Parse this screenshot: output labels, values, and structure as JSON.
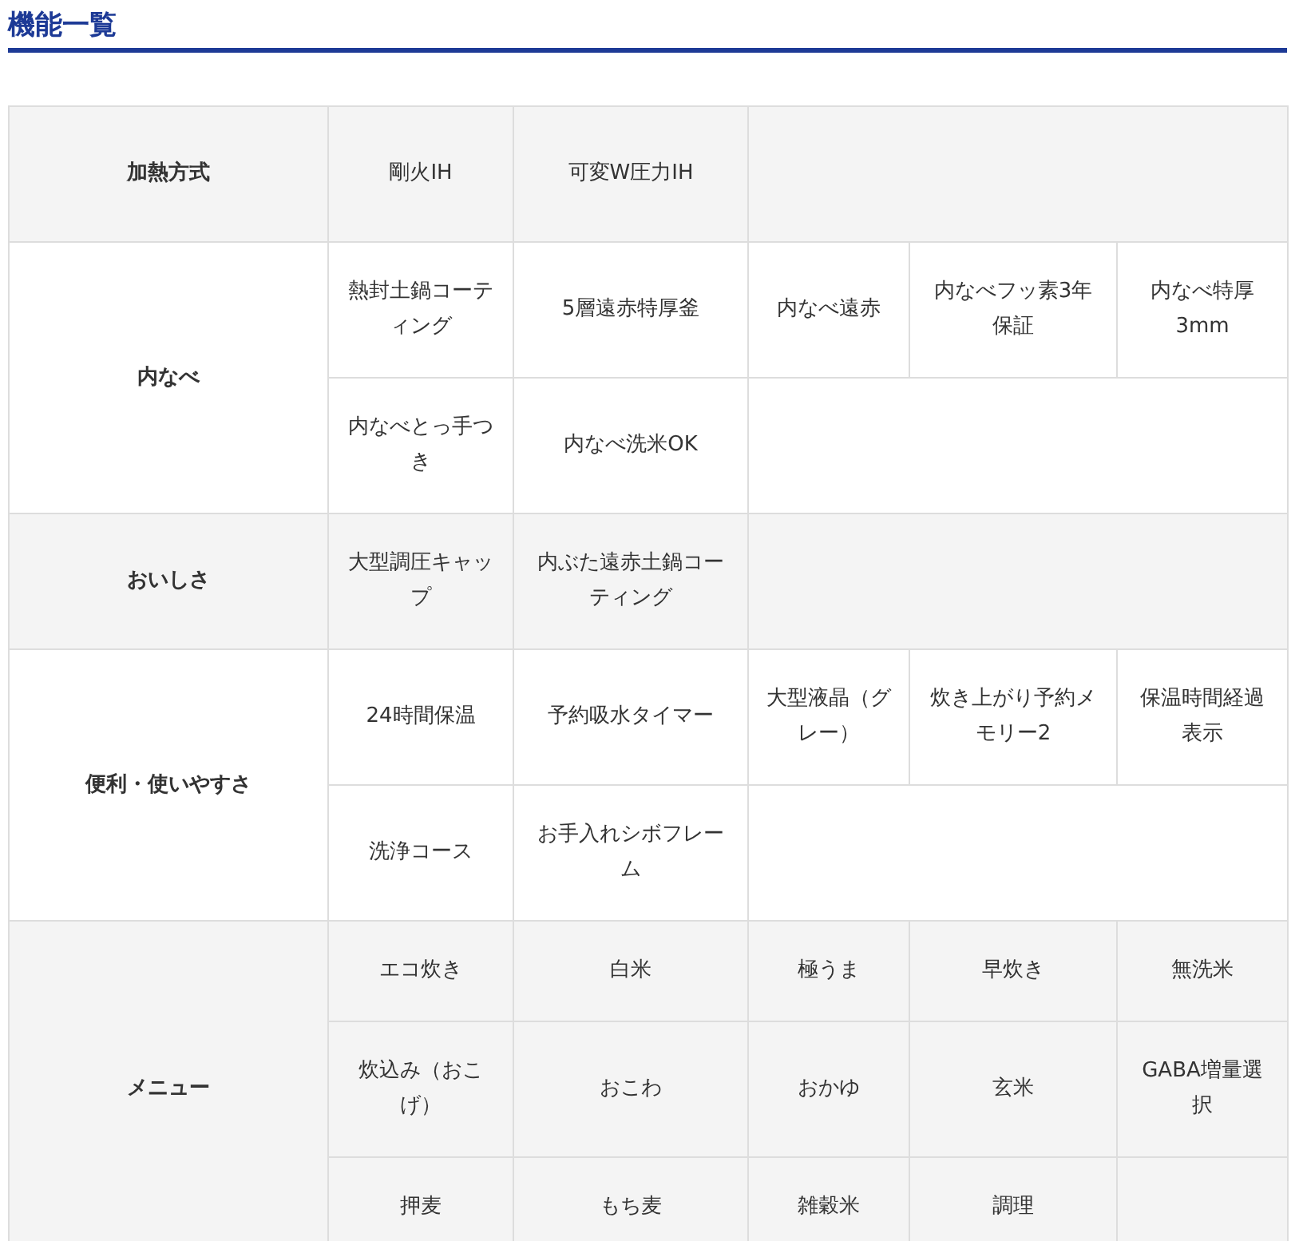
{
  "title": "機能一覧",
  "groups": [
    {
      "label": "加熱方式",
      "rows": [
        [
          "剛火IH",
          "可変W圧力IH"
        ]
      ]
    },
    {
      "label": "内なべ",
      "rows": [
        [
          "熱封土鍋コーティング",
          "5層遠赤特厚釜",
          "内なべ遠赤",
          "内なべフッ素3年保証",
          "内なべ特厚3mm"
        ],
        [
          "内なべとっ手つき",
          "内なべ洗米OK"
        ]
      ]
    },
    {
      "label": "おいしさ",
      "rows": [
        [
          "大型調圧キャップ",
          "内ぶた遠赤土鍋コーティング"
        ]
      ]
    },
    {
      "label": "便利・使いやすさ",
      "rows": [
        [
          "24時間保温",
          "予約吸水タイマー",
          "大型液晶（グレー）",
          "炊き上がり予約メモリー2",
          "保温時間経過表示"
        ],
        [
          "洗浄コース",
          "お手入れシボフレーム"
        ]
      ]
    },
    {
      "label": "メニュー",
      "rows": [
        [
          "エコ炊き",
          "白米",
          "極うま",
          "早炊き",
          "無洗米"
        ],
        [
          "炊込み（おこげ）",
          "おこわ",
          "おかゆ",
          "玄米",
          "GABA増量選択"
        ],
        [
          "押麦",
          "もち麦",
          "雑穀米",
          "調理"
        ]
      ]
    }
  ]
}
